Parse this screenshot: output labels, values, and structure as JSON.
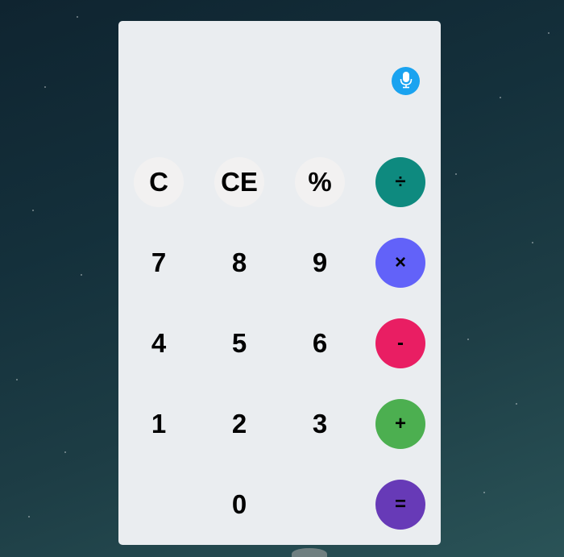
{
  "colors": {
    "panel": "#eaedf0",
    "function_key": "#f2f1f1",
    "mic": "#1aa3f0",
    "divide": "#0e8a7f",
    "multiply": "#6262f9",
    "subtract": "#e91e63",
    "add": "#4caf50",
    "equals": "#673ab7"
  },
  "icons": {
    "mic": "microphone-icon"
  },
  "keys": {
    "clear": "C",
    "clear_entry": "CE",
    "percent": "%",
    "divide": "÷",
    "seven": "7",
    "eight": "8",
    "nine": "9",
    "multiply": "×",
    "four": "4",
    "five": "5",
    "six": "6",
    "subtract": "-",
    "one": "1",
    "two": "2",
    "three": "3",
    "add": "+",
    "zero": "0",
    "equals": "="
  }
}
